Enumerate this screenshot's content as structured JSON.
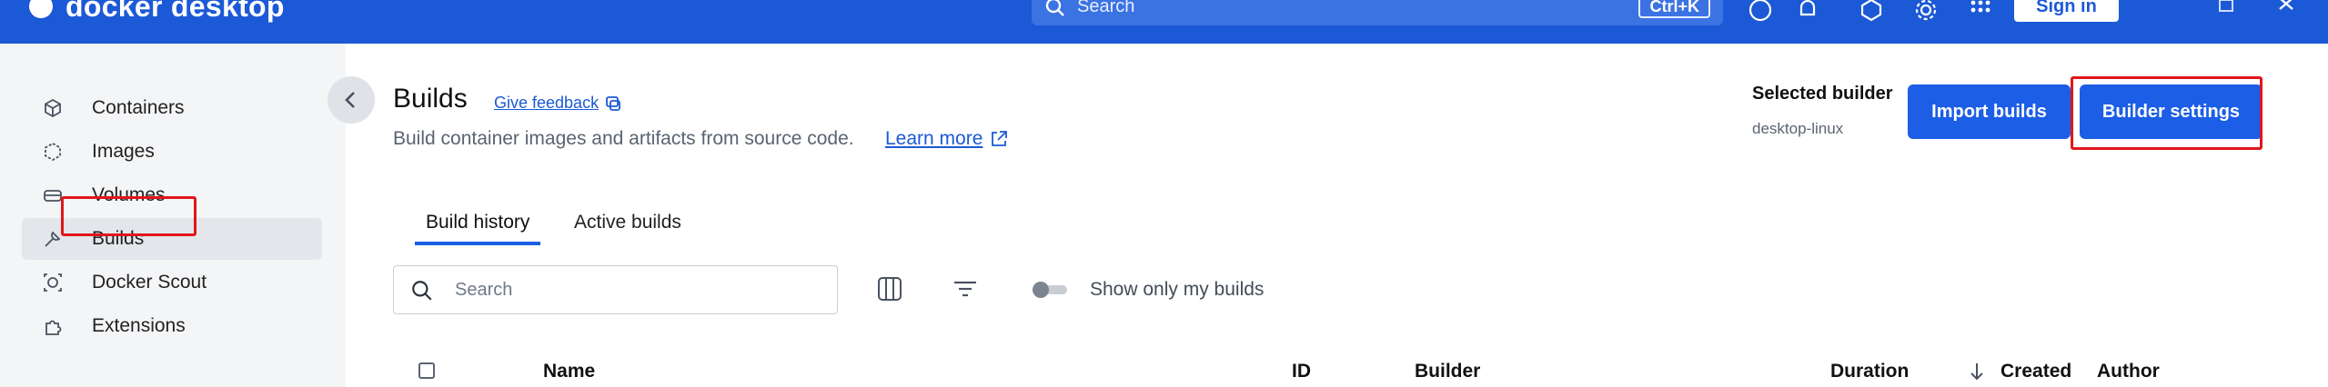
{
  "topbar": {
    "app_name": "docker desktop",
    "search_placeholder": "Search",
    "search_shortcut": "Ctrl+K",
    "sign_in_label": "Sign in",
    "brand_color": "#1c59d6",
    "icons": [
      "help-icon",
      "bell-icon",
      "extensions-icon",
      "gear-icon",
      "grid-icon",
      "window-icon",
      "close-icon"
    ]
  },
  "sidebar": {
    "items": [
      {
        "label": "Containers",
        "icon": "container-icon"
      },
      {
        "label": "Images",
        "icon": "images-icon"
      },
      {
        "label": "Volumes",
        "icon": "volumes-icon"
      },
      {
        "label": "Builds",
        "icon": "builds-icon",
        "active": true
      },
      {
        "label": "Docker Scout",
        "icon": "scout-icon"
      },
      {
        "label": "Extensions",
        "icon": "extensions-icon"
      }
    ]
  },
  "header": {
    "title": "Builds",
    "feedback": "Give feedback",
    "subtitle": "Build container images and artifacts from source code.",
    "learn_more": "Learn more",
    "selected_builder_label": "Selected builder",
    "selected_builder_value": "desktop-linux",
    "import_builds": "Import builds",
    "builder_settings": "Builder settings"
  },
  "tabs": [
    {
      "label": "Build history",
      "active": true
    },
    {
      "label": "Active builds",
      "active": false
    }
  ],
  "toolbar": {
    "search_placeholder": "Search",
    "toggle_label": "Show only my builds",
    "toggle_on": false
  },
  "table": {
    "columns": [
      "Name",
      "ID",
      "Builder",
      "Duration",
      "Created",
      "Author"
    ],
    "sort_column": "Created",
    "sort_direction": "descending"
  },
  "colors": {
    "accent": "#1c5ee6",
    "highlight": "#e0161b",
    "sidebar_bg": "#f4f5f7"
  }
}
